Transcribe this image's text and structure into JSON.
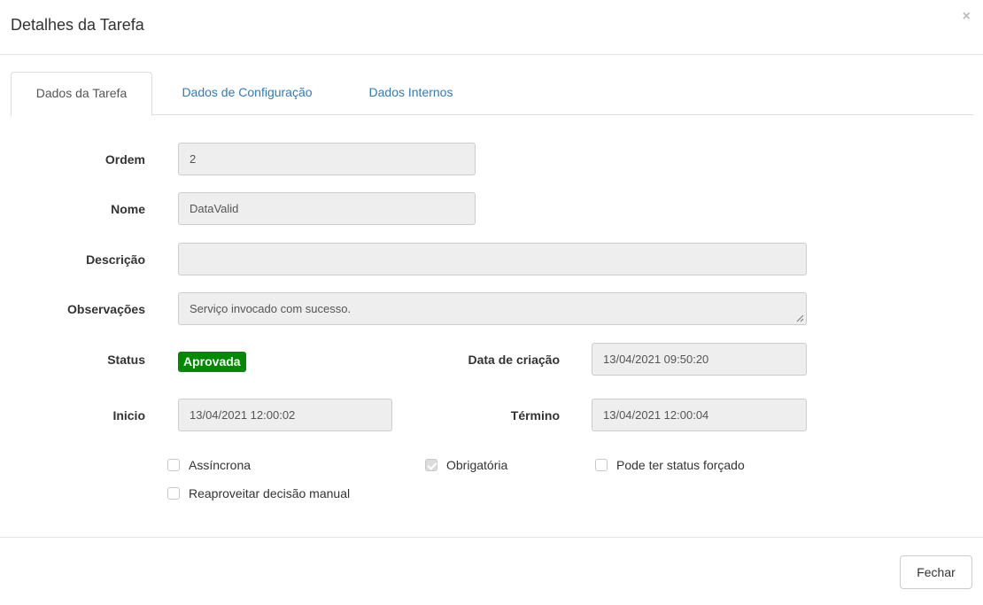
{
  "modal": {
    "title": "Detalhes da Tarefa",
    "close_glyph": "×"
  },
  "tabs": [
    {
      "label": "Dados da Tarefa",
      "active": true
    },
    {
      "label": "Dados de Configuração",
      "active": false
    },
    {
      "label": "Dados Internos",
      "active": false
    }
  ],
  "form": {
    "ordem": {
      "label": "Ordem",
      "value": "2"
    },
    "nome": {
      "label": "Nome",
      "value": "DataValid"
    },
    "descricao": {
      "label": "Descrição",
      "value": ""
    },
    "observacoes": {
      "label": "Observações",
      "value": "Serviço invocado com sucesso."
    },
    "status": {
      "label": "Status",
      "value": "Aprovada",
      "color": "#008a00"
    },
    "data_criacao": {
      "label": "Data de criação",
      "value": "13/04/2021 09:50:20"
    },
    "inicio": {
      "label": "Inicio",
      "value": "13/04/2021 12:00:02"
    },
    "termino": {
      "label": "Término",
      "value": "13/04/2021 12:00:04"
    }
  },
  "checkboxes": [
    {
      "label": "Assíncrona",
      "checked": false
    },
    {
      "label": "Obrigatória",
      "checked": true
    },
    {
      "label": "Pode ter status forçado",
      "checked": false
    },
    {
      "label": "Reaproveitar decisão manual",
      "checked": false
    }
  ],
  "footer": {
    "close_label": "Fechar"
  },
  "colors": {
    "link": "#337ab7",
    "field_bg": "#eeeeee"
  }
}
